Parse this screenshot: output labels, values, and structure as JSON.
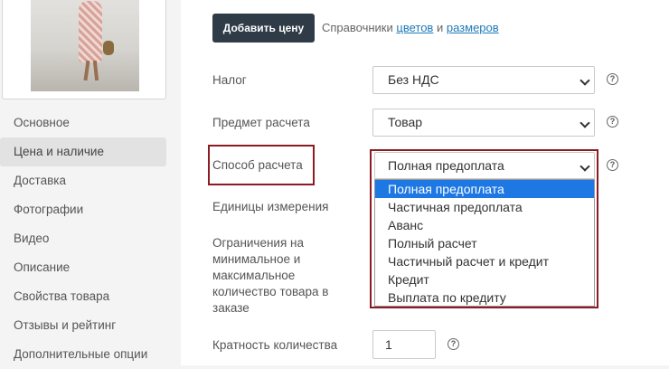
{
  "sidebar": {
    "items": [
      {
        "label": "Основное"
      },
      {
        "label": "Цена и наличие"
      },
      {
        "label": "Доставка"
      },
      {
        "label": "Фотографии"
      },
      {
        "label": "Видео"
      },
      {
        "label": "Описание"
      },
      {
        "label": "Свойства товара"
      },
      {
        "label": "Отзывы и рейтинг"
      },
      {
        "label": "Дополнительные опции"
      }
    ],
    "active_index": 1
  },
  "toolbar": {
    "add_price_label": "Добавить цену",
    "refs_prefix": "Справочники",
    "colors_link": "цветов",
    "refs_and": "и",
    "sizes_link": "размеров"
  },
  "form": {
    "tax": {
      "label": "Налог",
      "value": "Без НДС"
    },
    "subject": {
      "label": "Предмет расчета",
      "value": "Товар"
    },
    "method": {
      "label": "Способ расчета",
      "value": "Полная предоплата",
      "options": [
        "Полная предоплата",
        "Частичная предоплата",
        "Аванс",
        "Полный расчет",
        "Частичный расчет и кредит",
        "Кредит",
        "Выплата по кредиту"
      ],
      "selected_index": 0
    },
    "units": {
      "label": "Единицы измерения"
    },
    "limits": {
      "label": "Ограничения на минимальное и максимальное количество товара в заказе"
    },
    "multiplicity": {
      "label": "Кратность количества",
      "value": "1"
    },
    "help_glyph": "?"
  },
  "colors": {
    "highlight": "#8b1c23",
    "button_bg": "#2f3b47",
    "link": "#1f7ab8",
    "option_selected": "#1e78e4"
  },
  "icons": {
    "help": "question-circle-icon",
    "chevron": "chevron-down-icon"
  }
}
